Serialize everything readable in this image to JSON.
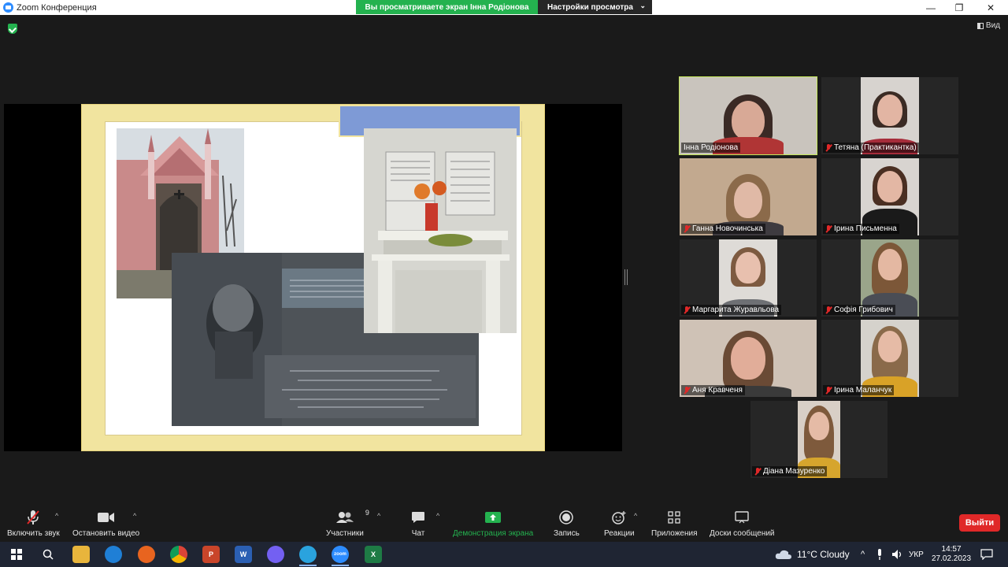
{
  "window": {
    "title": "Zoom Конференция"
  },
  "share_banner": {
    "info": "Вы просматриваете экран Інна Родіонова",
    "settings": "Настройки просмотра"
  },
  "view_button": {
    "label": "Вид"
  },
  "participants": [
    {
      "name": "Інна Родіонова",
      "muted": false,
      "active": true
    },
    {
      "name": "Тетяна (Практикантка)",
      "muted": true
    },
    {
      "name": "Ганна Новочинська",
      "muted": true
    },
    {
      "name": "Ірина Письменна",
      "muted": true
    },
    {
      "name": "Маргарита Журавльова",
      "muted": true
    },
    {
      "name": "Софія Грибович",
      "muted": true
    },
    {
      "name": "Аня Кравченя",
      "muted": true
    },
    {
      "name": "Ірина Маланчук",
      "muted": true
    },
    {
      "name": "Діана Мазуренко",
      "muted": true
    }
  ],
  "toolbar": {
    "unmute": "Включить звук",
    "stop_video": "Остановить видео",
    "participants": "Участники",
    "participants_count": "9",
    "chat": "Чат",
    "share_screen": "Демонстрация экрана",
    "record": "Запись",
    "reactions": "Реакции",
    "apps": "Приложения",
    "whiteboards": "Доски сообщений",
    "leave": "Выйти"
  },
  "taskbar": {
    "weather": "11°C Cloudy",
    "language": "УКР",
    "time": "14:57",
    "date": "27.02.2023",
    "word_letter": "W",
    "excel_letter": "X",
    "ppt_letter": "P",
    "zoom_label": "zoom"
  },
  "colors": {
    "accent_green": "#24b24f",
    "leave_red": "#e02828",
    "active_border": "#c5e85a"
  }
}
